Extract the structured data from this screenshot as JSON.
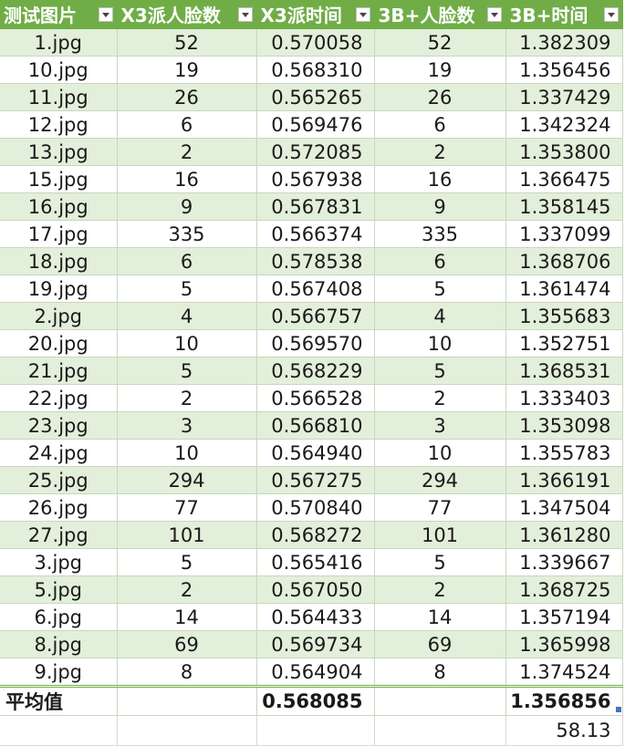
{
  "headers": [
    "测试图片",
    "X3派人脸数",
    "X3派时间",
    "3B+人脸数",
    "3B+时间"
  ],
  "rows": [
    {
      "name": "1.jpg",
      "x3_faces": "52",
      "x3_time": "0.570058",
      "pi_faces": "52",
      "pi_time": "1.382309"
    },
    {
      "name": "10.jpg",
      "x3_faces": "19",
      "x3_time": "0.568310",
      "pi_faces": "19",
      "pi_time": "1.356456"
    },
    {
      "name": "11.jpg",
      "x3_faces": "26",
      "x3_time": "0.565265",
      "pi_faces": "26",
      "pi_time": "1.337429"
    },
    {
      "name": "12.jpg",
      "x3_faces": "6",
      "x3_time": "0.569476",
      "pi_faces": "6",
      "pi_time": "1.342324"
    },
    {
      "name": "13.jpg",
      "x3_faces": "2",
      "x3_time": "0.572085",
      "pi_faces": "2",
      "pi_time": "1.353800"
    },
    {
      "name": "15.jpg",
      "x3_faces": "16",
      "x3_time": "0.567938",
      "pi_faces": "16",
      "pi_time": "1.366475"
    },
    {
      "name": "16.jpg",
      "x3_faces": "9",
      "x3_time": "0.567831",
      "pi_faces": "9",
      "pi_time": "1.358145"
    },
    {
      "name": "17.jpg",
      "x3_faces": "335",
      "x3_time": "0.566374",
      "pi_faces": "335",
      "pi_time": "1.337099"
    },
    {
      "name": "18.jpg",
      "x3_faces": "6",
      "x3_time": "0.578538",
      "pi_faces": "6",
      "pi_time": "1.368706"
    },
    {
      "name": "19.jpg",
      "x3_faces": "5",
      "x3_time": "0.567408",
      "pi_faces": "5",
      "pi_time": "1.361474"
    },
    {
      "name": "2.jpg",
      "x3_faces": "4",
      "x3_time": "0.566757",
      "pi_faces": "4",
      "pi_time": "1.355683"
    },
    {
      "name": "20.jpg",
      "x3_faces": "10",
      "x3_time": "0.569570",
      "pi_faces": "10",
      "pi_time": "1.352751"
    },
    {
      "name": "21.jpg",
      "x3_faces": "5",
      "x3_time": "0.568229",
      "pi_faces": "5",
      "pi_time": "1.368531"
    },
    {
      "name": "22.jpg",
      "x3_faces": "2",
      "x3_time": "0.566528",
      "pi_faces": "2",
      "pi_time": "1.333403"
    },
    {
      "name": "23.jpg",
      "x3_faces": "3",
      "x3_time": "0.566810",
      "pi_faces": "3",
      "pi_time": "1.353098"
    },
    {
      "name": "24.jpg",
      "x3_faces": "10",
      "x3_time": "0.564940",
      "pi_faces": "10",
      "pi_time": "1.355783"
    },
    {
      "name": "25.jpg",
      "x3_faces": "294",
      "x3_time": "0.567275",
      "pi_faces": "294",
      "pi_time": "1.366191"
    },
    {
      "name": "26.jpg",
      "x3_faces": "77",
      "x3_time": "0.570840",
      "pi_faces": "77",
      "pi_time": "1.347504"
    },
    {
      "name": "27.jpg",
      "x3_faces": "101",
      "x3_time": "0.568272",
      "pi_faces": "101",
      "pi_time": "1.361280"
    },
    {
      "name": "3.jpg",
      "x3_faces": "5",
      "x3_time": "0.565416",
      "pi_faces": "5",
      "pi_time": "1.339667"
    },
    {
      "name": "5.jpg",
      "x3_faces": "2",
      "x3_time": "0.567050",
      "pi_faces": "2",
      "pi_time": "1.368725"
    },
    {
      "name": "6.jpg",
      "x3_faces": "14",
      "x3_time": "0.564433",
      "pi_faces": "14",
      "pi_time": "1.357194"
    },
    {
      "name": "8.jpg",
      "x3_faces": "69",
      "x3_time": "0.569734",
      "pi_faces": "69",
      "pi_time": "1.365998"
    },
    {
      "name": "9.jpg",
      "x3_faces": "8",
      "x3_time": "0.564904",
      "pi_faces": "8",
      "pi_time": "1.374524"
    }
  ],
  "average": {
    "label": "平均值",
    "x3_time": "0.568085",
    "pi_time": "1.356856"
  },
  "extra": {
    "pi_value": "58.13"
  },
  "colors": {
    "header": "#70ad47",
    "band": "#e2efda",
    "handle": "#4472c4"
  },
  "icons": {
    "filter": "filter-dropdown-icon"
  }
}
